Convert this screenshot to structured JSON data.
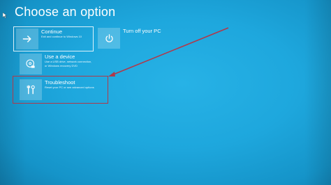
{
  "page": {
    "title": "Choose an option"
  },
  "options": {
    "continue": {
      "title": "Continue",
      "description": "Exit and continue to Windows 10",
      "icon": "arrow-right-icon"
    },
    "turn_off": {
      "title": "Turn off your PC",
      "icon": "power-icon"
    },
    "use_device": {
      "title": "Use a device",
      "description_lines": [
        "Use a USB drive, network connection,",
        "or Windows recovery DVD"
      ],
      "icon": "disc-icon"
    },
    "troubleshoot": {
      "title": "Troubleshoot",
      "description": "Reset your PC or see advanced options",
      "icon": "tools-icon"
    }
  },
  "annotation": {
    "color": "#b0394a"
  },
  "colors": {
    "background": "#1ea7dd",
    "tile_icon_bg": "rgba(255,255,255,0.22)",
    "text": "#ffffff"
  }
}
